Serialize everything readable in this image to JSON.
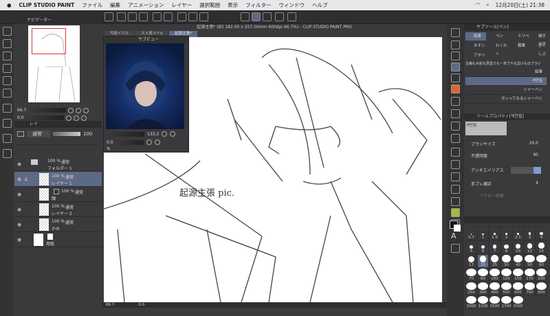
{
  "menubar": {
    "app": "CLIP STUDIO PAINT",
    "items": [
      "ファイル",
      "編集",
      "アニメーション",
      "レイヤー",
      "選択範囲",
      "表示",
      "フィルター",
      "ウィンドウ",
      "ヘルプ"
    ],
    "clock": "12月20日(土) 21:38"
  },
  "navigator": {
    "title": "ナビゲーター",
    "zoom": "66.7",
    "angle": "0.0"
  },
  "layer_panel": {
    "tab": "レイ",
    "blend": "通常",
    "opacity": "100",
    "layers": [
      {
        "pct": "100 %",
        "mode": "通常",
        "name": "フォルダー 1"
      },
      {
        "pct": "100 %",
        "mode": "通常",
        "name": "レイヤー 1"
      },
      {
        "pct": "100 %",
        "mode": "通常",
        "name": "顔"
      },
      {
        "pct": "100 %",
        "mode": "通常",
        "name": "レイヤー 2"
      },
      {
        "pct": "100 %",
        "mode": "通常",
        "name": "かみ"
      },
      {
        "pct": "",
        "mode": "",
        "name": "用紙"
      }
    ]
  },
  "document": {
    "title": "起源主張* (B5 182.00 x 257.00mm 600dpi 66.7%) - CLIP STUDIO PAINT PRO",
    "tabs": [
      "写経イクス",
      "スメ男メイd",
      "起源主張*"
    ],
    "canvas_text": "起源主張 pic.",
    "zoom": "66.7",
    "angle": "0.0"
  },
  "subview": {
    "title": "サブビュー",
    "zoom": "133.2",
    "angle": "0.0"
  },
  "subtool": {
    "title": "サブツール[ペン]",
    "tools": [
      "鉛筆",
      "ペン",
      "ミリペン",
      "描き文字",
      "ネオン",
      "わくわく",
      "鉛筆",
      "ぴくしぶ",
      "アタリ"
    ],
    "group": "主線も水彩も厚塗りも一本でやる怠けものブラシ",
    "brushes": [
      "鉛筆",
      "색연필",
      "シャーペン",
      "ガッってなるシャーペン"
    ]
  },
  "tool_property": {
    "title": "ツールプロパティ[색연필]",
    "preview": "색연필",
    "brush_size_label": "ブラシサイズ",
    "brush_size": "20.0",
    "opacity_label": "不透明度",
    "opacity": "90",
    "antialias_label": "アンチエイリアス",
    "stabilize_label": "手ブレ補正",
    "stabilize": "4",
    "vector_label": "ベクター吸着"
  },
  "brush_sizes": {
    "values": [
      "0.7",
      "1",
      "1.5",
      "2",
      "2.5",
      "3",
      "4",
      "5",
      "6",
      "7",
      "8",
      "10",
      "12",
      "15",
      "17",
      "20",
      "25",
      "30",
      "40",
      "50",
      "60",
      "70",
      "80",
      "100",
      "120",
      "150",
      "170",
      "200",
      "250",
      "300",
      "400",
      "500",
      "600",
      "700",
      "800",
      "1000",
      "1200",
      "1500",
      "1700",
      "2000"
    ],
    "selected": "20"
  }
}
